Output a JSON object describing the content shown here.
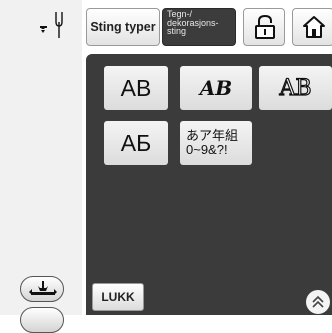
{
  "tabs": {
    "sting_typer": "Sting typer",
    "tegn_line1": "Tegn-/",
    "tegn_line2": "dekorasjons-",
    "tegn_line3": "sting"
  },
  "fonts": {
    "font1": "AB",
    "font2": "AB",
    "font3": "AB",
    "font4": "AБ",
    "font5_line1": "あア年組",
    "font5_line2": "0~9&?!"
  },
  "footer": {
    "close_label": "LUKK"
  },
  "icons": {
    "needle": "needle-position-icon",
    "presser_foot": "presser-foot-icon",
    "lock": "lock-icon",
    "home": "home-icon",
    "scroll_up": "double-chevron-up-icon"
  },
  "colors": {
    "panel_bg": "#3b3b3b",
    "active_tab": "#3c3c3c"
  }
}
